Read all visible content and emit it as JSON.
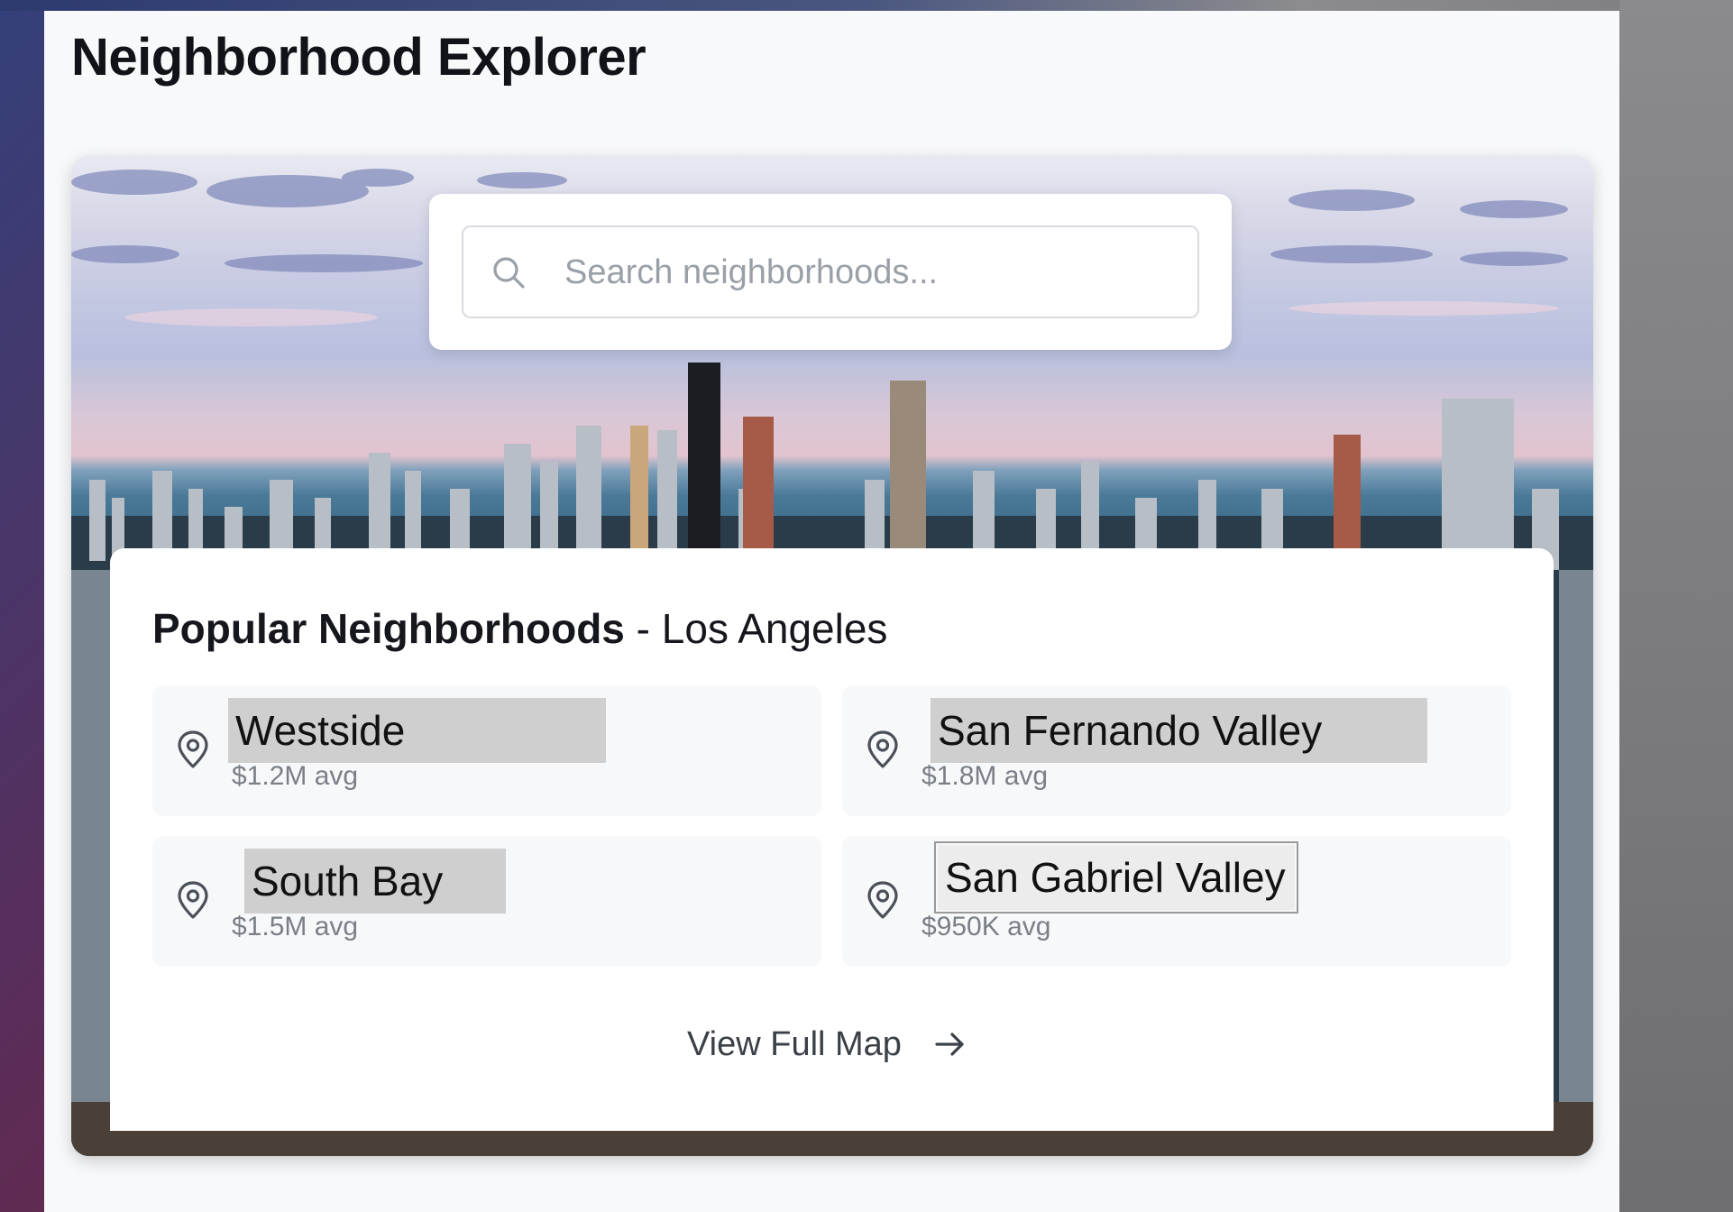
{
  "app": {
    "title": "Neighborhood Explorer"
  },
  "search": {
    "placeholder": "Search neighborhoods...",
    "icon": "search-icon"
  },
  "popular": {
    "heading": "Popular Neighborhoods",
    "separator": " - ",
    "city": "Los Angeles",
    "items": [
      {
        "name": "Westside",
        "price": "$1.2M avg",
        "icon": "map-pin-icon"
      },
      {
        "name": "San Fernando Valley",
        "price": "$1.8M avg",
        "icon": "map-pin-icon"
      },
      {
        "name": "South Bay",
        "price": "$1.5M avg",
        "icon": "map-pin-icon"
      },
      {
        "name": "San Gabriel Valley",
        "price": "$950K avg",
        "icon": "map-pin-icon"
      }
    ]
  },
  "footer_link": {
    "label": "View Full Map",
    "icon": "arrow-right-icon"
  }
}
